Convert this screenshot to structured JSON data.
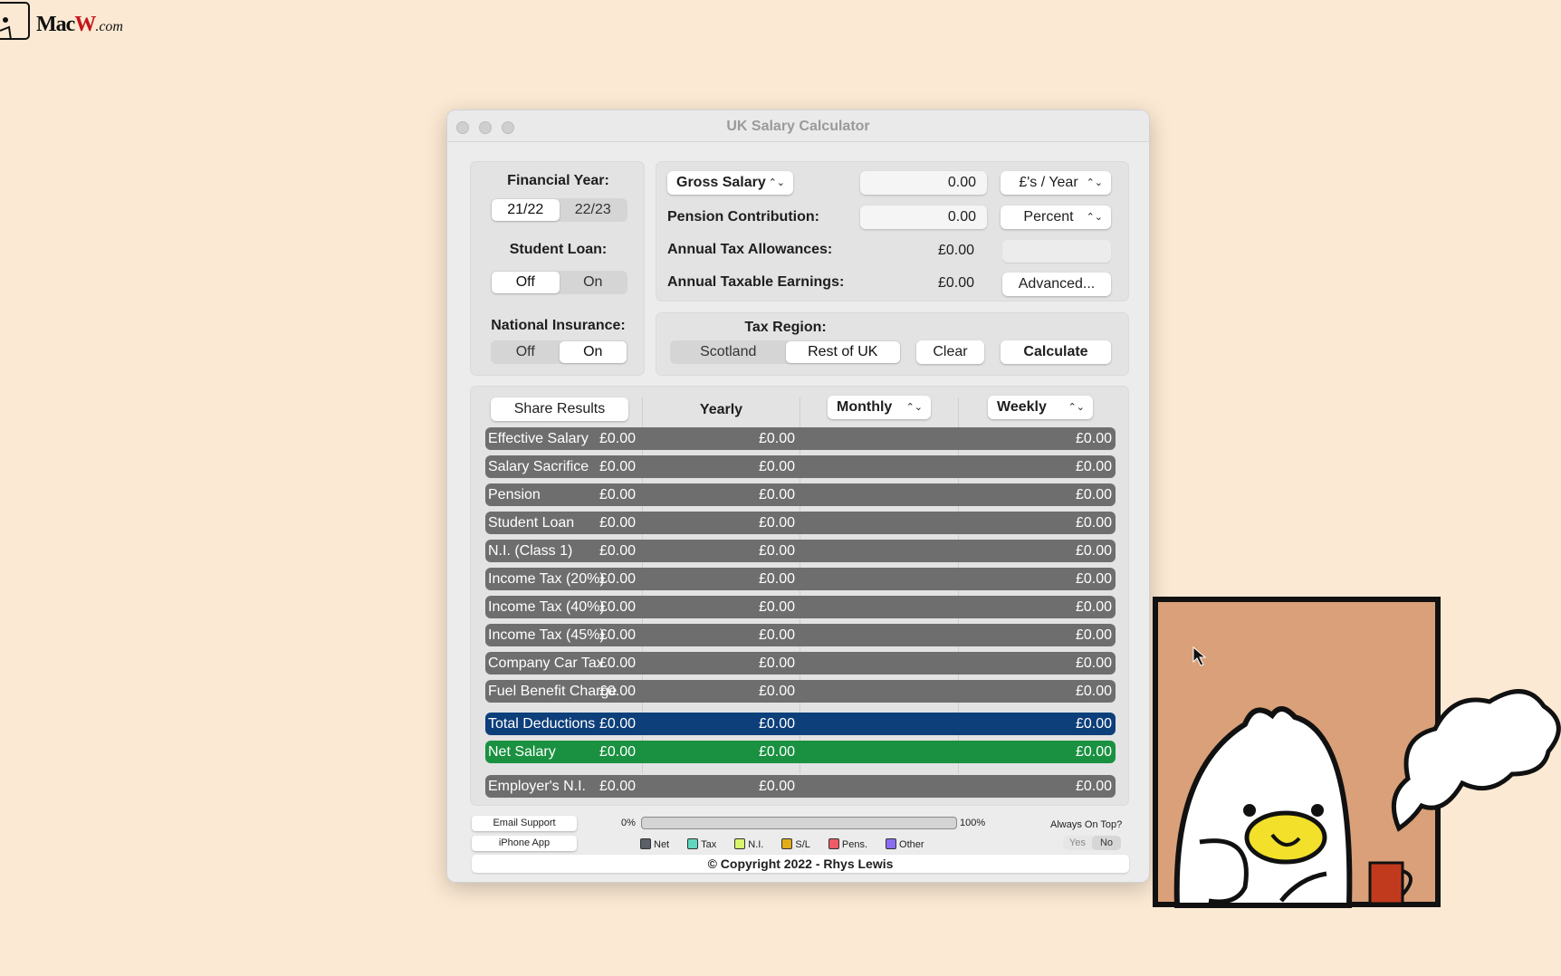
{
  "watermark": {
    "brand": "MacW",
    "suffix": ".com"
  },
  "window": {
    "title": "UK Salary Calculator"
  },
  "left": {
    "financial_year_label": "Financial Year:",
    "years": [
      "21/22",
      "22/23"
    ],
    "year_selected": "21/22",
    "student_loan_label": "Student Loan:",
    "student_loan": [
      "Off",
      "On"
    ],
    "student_loan_selected": "Off",
    "ni_label": "National Insurance:",
    "ni": [
      "Off",
      "On"
    ],
    "ni_selected": "On"
  },
  "inputs": {
    "salary_type": "Gross Salary",
    "salary_value": "0.00",
    "salary_period": "£'s / Year",
    "pension_label": "Pension Contribution:",
    "pension_value": "0.00",
    "pension_unit": "Percent",
    "allowances_label": "Annual Tax Allowances:",
    "allowances_value": "£0.00",
    "taxable_label": "Annual Taxable Earnings:",
    "taxable_value": "£0.00",
    "advanced": "Advanced..."
  },
  "tax_region": {
    "label": "Tax Region:",
    "options": [
      "Scotland",
      "Rest of UK"
    ],
    "selected": "Rest of UK",
    "clear": "Clear",
    "calculate": "Calculate"
  },
  "results": {
    "share": "Share Results",
    "col_yearly": "Yearly",
    "col_monthly": "Monthly",
    "col_weekly": "Weekly",
    "rows": [
      {
        "name": "Effective Salary",
        "yearly": "£0.00",
        "monthly": "£0.00",
        "weekly": "£0.00"
      },
      {
        "name": "Salary Sacrifice",
        "yearly": "£0.00",
        "monthly": "£0.00",
        "weekly": "£0.00"
      },
      {
        "name": "Pension",
        "yearly": "£0.00",
        "monthly": "£0.00",
        "weekly": "£0.00"
      },
      {
        "name": "Student Loan",
        "yearly": "£0.00",
        "monthly": "£0.00",
        "weekly": "£0.00"
      },
      {
        "name": "N.I. (Class 1)",
        "yearly": "£0.00",
        "monthly": "£0.00",
        "weekly": "£0.00"
      },
      {
        "name": "Income Tax (20%)",
        "yearly": "£0.00",
        "monthly": "£0.00",
        "weekly": "£0.00"
      },
      {
        "name": "Income Tax (40%)",
        "yearly": "£0.00",
        "monthly": "£0.00",
        "weekly": "£0.00"
      },
      {
        "name": "Income Tax (45%)",
        "yearly": "£0.00",
        "monthly": "£0.00",
        "weekly": "£0.00"
      },
      {
        "name": "Company Car Tax",
        "yearly": "£0.00",
        "monthly": "£0.00",
        "weekly": "£0.00"
      },
      {
        "name": "Fuel Benefit Charge",
        "yearly": "£0.00",
        "monthly": "£0.00",
        "weekly": "£0.00"
      }
    ],
    "total": {
      "name": "Total Deductions",
      "yearly": "£0.00",
      "monthly": "£0.00",
      "weekly": "£0.00",
      "color": "#0d3f7a"
    },
    "net": {
      "name": "Net Salary",
      "yearly": "£0.00",
      "monthly": "£0.00",
      "weekly": "£0.00",
      "color": "#1a9140"
    },
    "employer": {
      "name": "Employer's N.I.",
      "yearly": "£0.00",
      "monthly": "£0.00",
      "weekly": "£0.00"
    }
  },
  "footer": {
    "email": "Email Support",
    "iphone": "iPhone App",
    "progress_min": "0%",
    "progress_max": "100%",
    "progress_value": 0,
    "legend": [
      {
        "label": "Net",
        "color": "#5a5f68"
      },
      {
        "label": "Tax",
        "color": "#5fd6c0"
      },
      {
        "label": "N.I.",
        "color": "#d8f56a"
      },
      {
        "label": "S/L",
        "color": "#e0ac1a"
      },
      {
        "label": "Pens.",
        "color": "#ee5a66"
      },
      {
        "label": "Other",
        "color": "#8a6cf0"
      }
    ],
    "always_on_top": "Always On Top?",
    "yes": "Yes",
    "no": "No",
    "aot_selected": "No",
    "copyright": "© Copyright 2022 - Rhys Lewis"
  }
}
